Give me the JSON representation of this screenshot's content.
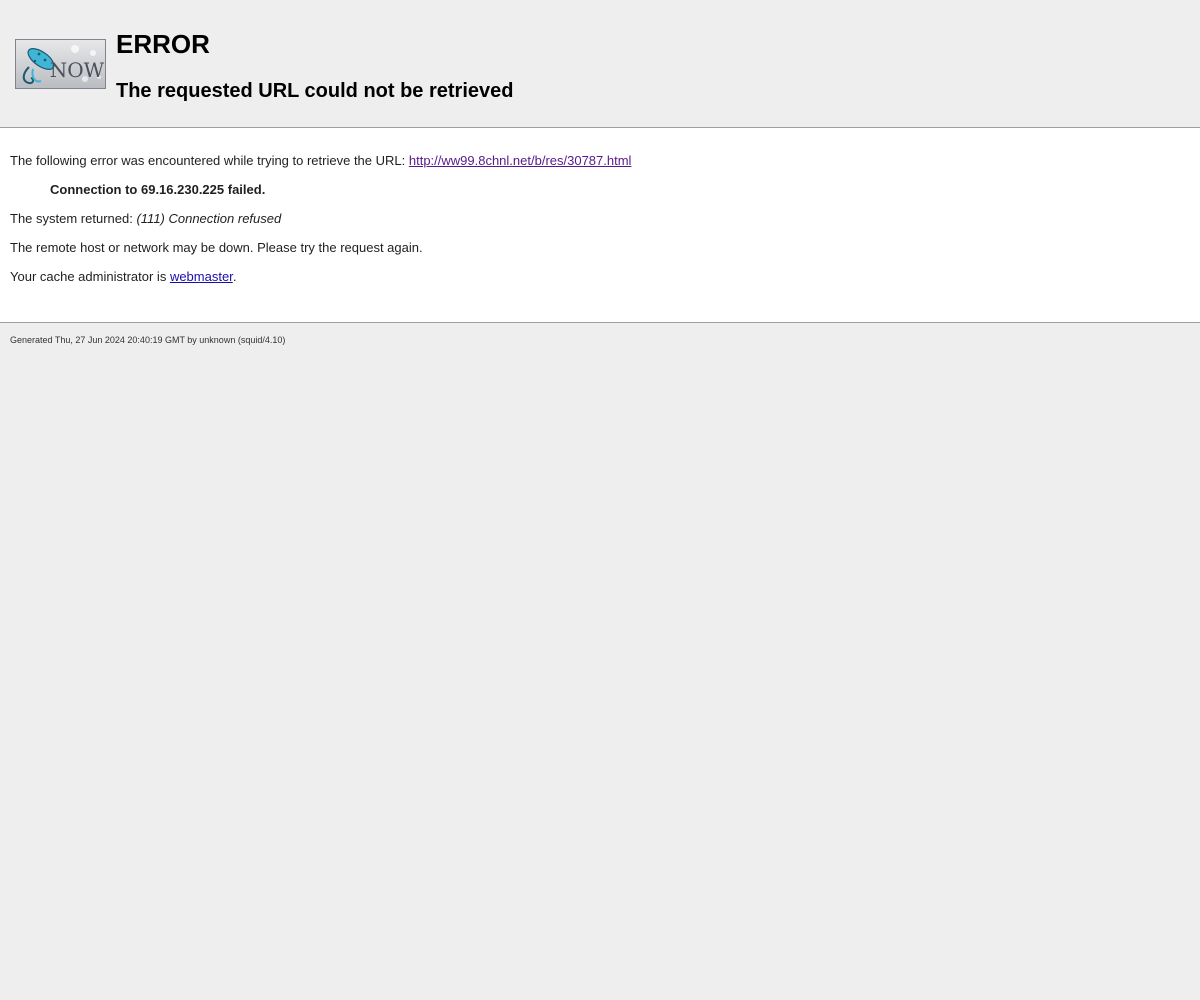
{
  "header": {
    "logo_text": "NOW",
    "title": "ERROR",
    "subtitle": "The requested URL could not be retrieved"
  },
  "content": {
    "line1_prefix": "The following error was encountered while trying to retrieve the URL: ",
    "url": "http://ww99.8chnl.net/b/res/30787.html",
    "connection_failed": "Connection to 69.16.230.225 failed.",
    "system_prefix": "The system returned: ",
    "system_error": "(111) Connection refused",
    "remote_down": "The remote host or network may be down. Please try the request again.",
    "admin_prefix": "Your cache administrator is ",
    "admin_link": "webmaster",
    "admin_suffix": "."
  },
  "footer": {
    "generated": "Generated Thu, 27 Jun 2024 20:40:19 GMT by unknown (squid/4.10)"
  },
  "colors": {
    "background": "#eeeeee",
    "content_background": "#ffffff",
    "visited_link": "#551a8b",
    "link": "#1a0dab"
  }
}
